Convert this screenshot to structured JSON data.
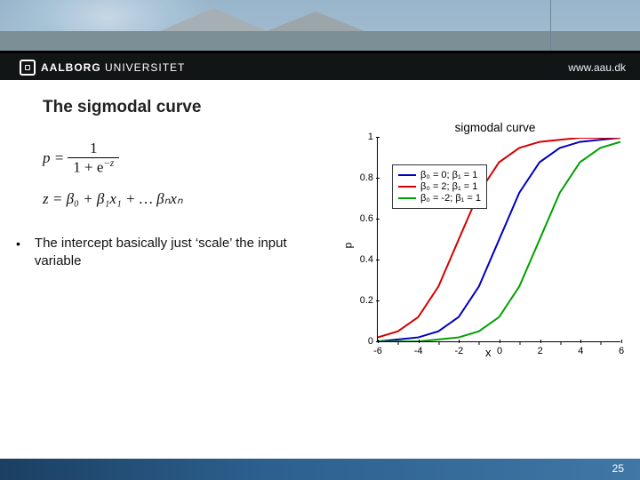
{
  "header": {
    "logo_bold": "AALBORG",
    "logo_rest": "UNIVERSITET",
    "url": "www.aau.dk"
  },
  "title": "The sigmodal curve",
  "formula": {
    "line1_pre": "p = ",
    "line1_num": "1",
    "line1_den_pre": "1 + e",
    "line1_den_sup": "−z",
    "line2": "z = β₀ + β₁x₁ + … βₙxₙ"
  },
  "bullet": "The intercept basically just ‘scale’ the input variable",
  "chart_data": {
    "type": "line",
    "title": "sigmodal curve",
    "xlabel": "x",
    "ylabel": "p",
    "xlim": [
      -6,
      6
    ],
    "ylim": [
      0,
      1
    ],
    "xticks": [
      -6,
      -4,
      -2,
      0,
      2,
      4,
      6
    ],
    "yticks": [
      0,
      0.2,
      0.4,
      0.6,
      0.8,
      1
    ],
    "series": [
      {
        "name": "β₀ = 0; β₁ = 1",
        "color": "#0000c0",
        "x": [
          -6,
          -5,
          -4,
          -3,
          -2,
          -1,
          0,
          1,
          2,
          3,
          4,
          5,
          6
        ],
        "y": [
          0.0,
          0.01,
          0.02,
          0.05,
          0.12,
          0.27,
          0.5,
          0.73,
          0.88,
          0.95,
          0.98,
          0.99,
          1.0
        ]
      },
      {
        "name": "β₀ = 2; β₁ = 1",
        "color": "#d40000",
        "x": [
          -6,
          -5,
          -4,
          -3,
          -2,
          -1,
          0,
          1,
          2,
          3,
          4,
          5,
          6
        ],
        "y": [
          0.02,
          0.05,
          0.12,
          0.27,
          0.5,
          0.73,
          0.88,
          0.95,
          0.98,
          0.99,
          1.0,
          1.0,
          1.0
        ]
      },
      {
        "name": "β₀ = -2; β₁ = 1",
        "color": "#00a000",
        "x": [
          -6,
          -5,
          -4,
          -3,
          -2,
          -1,
          0,
          1,
          2,
          3,
          4,
          5,
          6
        ],
        "y": [
          0.0,
          0.0,
          0.0,
          0.01,
          0.02,
          0.05,
          0.12,
          0.27,
          0.5,
          0.73,
          0.88,
          0.95,
          0.98
        ]
      }
    ]
  },
  "page_number": "25"
}
